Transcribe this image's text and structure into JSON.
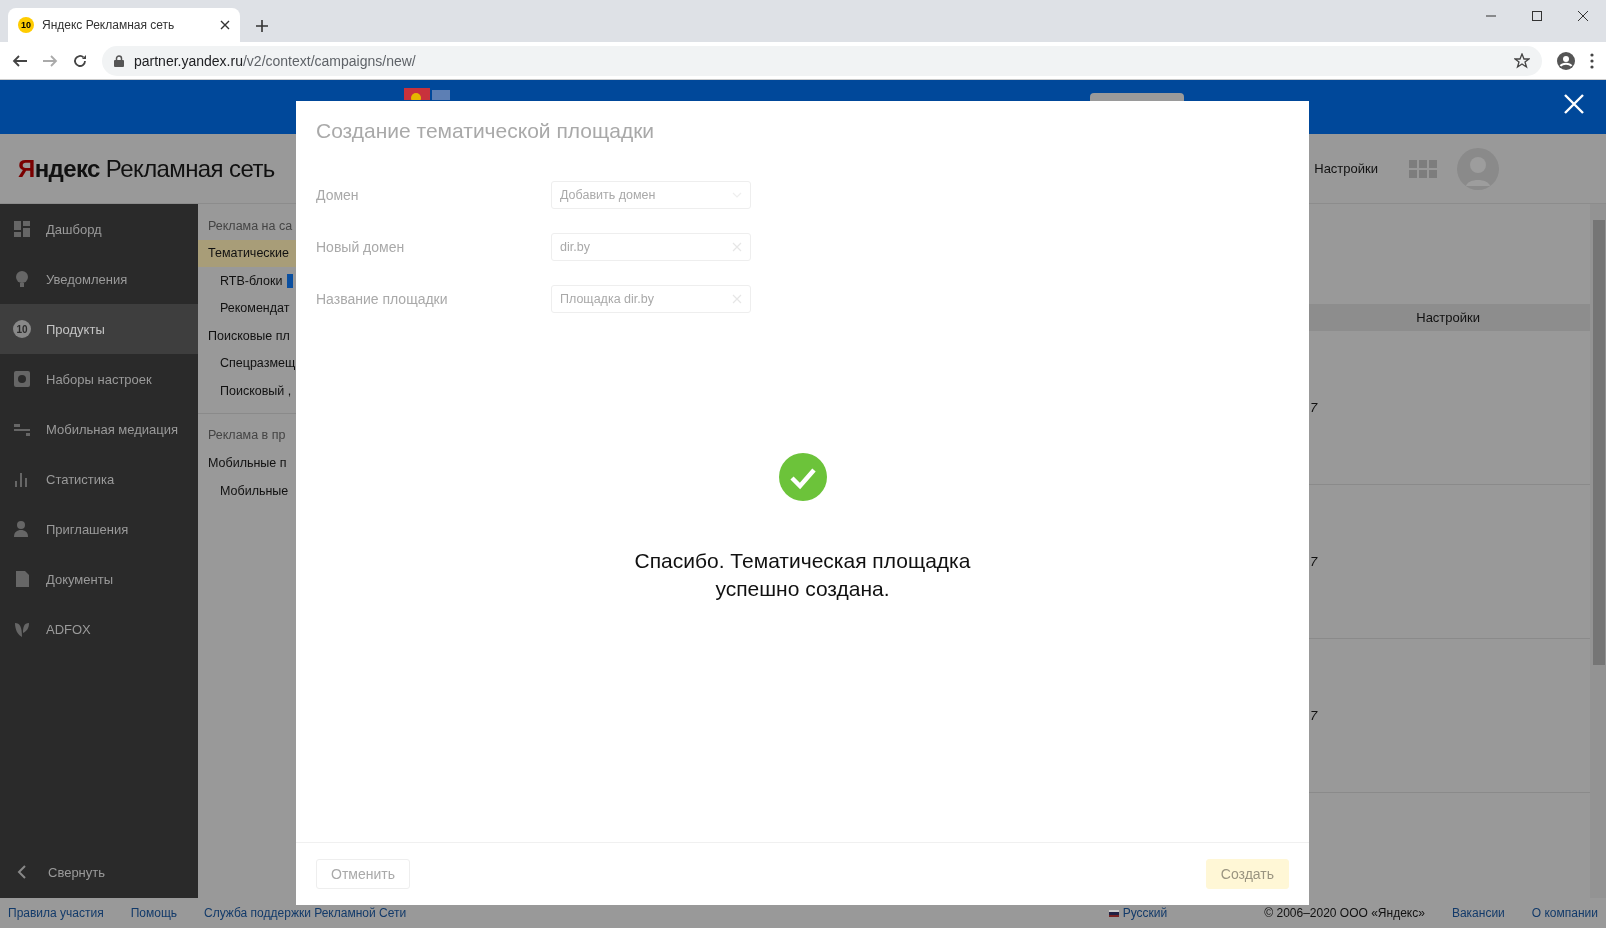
{
  "browser": {
    "tab": {
      "favicon": "10",
      "title": "Яндекс Рекламная сеть",
      "selected": true
    },
    "url_host": "partner.yandex.ru",
    "url_path": "/v2/context/campaigns/new/"
  },
  "header": {
    "logo_brand": "Яндекс",
    "logo_product": "Рекламная сеть",
    "settings": "Настройки"
  },
  "sidebar": {
    "items": [
      {
        "label": "Дашборд",
        "selected": false
      },
      {
        "label": "Уведомления",
        "selected": false
      },
      {
        "label": "Продукты",
        "selected": true,
        "badge": "10"
      },
      {
        "label": "Наборы настроек",
        "selected": false
      },
      {
        "label": "Мобильная медиация",
        "selected": false
      },
      {
        "label": "Статистика",
        "selected": false
      },
      {
        "label": "Приглашения",
        "selected": false
      },
      {
        "label": "Документы",
        "selected": false
      },
      {
        "label": "ADFOX",
        "selected": false
      }
    ],
    "collapse": "Свернуть"
  },
  "submenu": [
    {
      "kind": "heading",
      "label": "Реклама на са"
    },
    {
      "kind": "group",
      "label": "Тематические",
      "selected": true
    },
    {
      "kind": "item",
      "label": "RTB-блоки",
      "tag": true
    },
    {
      "kind": "item",
      "label": "Рекомендат"
    },
    {
      "kind": "group",
      "label": "Поисковые пл"
    },
    {
      "kind": "item",
      "label": "Спецразмещ"
    },
    {
      "kind": "item",
      "label": "Поисковый ,"
    },
    {
      "kind": "heading",
      "label": "Реклама в пр",
      "divider": true
    },
    {
      "kind": "group",
      "label": "Мобильные п"
    },
    {
      "kind": "item",
      "label": "Мобильные"
    }
  ],
  "table": {
    "header": "Настройки",
    "rows": [
      "7",
      "7",
      "7"
    ]
  },
  "footer": {
    "links": [
      "Правила участия",
      "Помощь",
      "Служба поддержки Рекламной Сети"
    ],
    "language": "Русский",
    "copyright": "© 2006–2020 ООО «Яндекс»",
    "right_links": [
      "Вакансии",
      "О компании"
    ]
  },
  "modal": {
    "title": "Создание тематической площадки",
    "faded": true,
    "fields": [
      {
        "kind": "select",
        "label": "Домен",
        "placeholder": "Добавить домен"
      },
      {
        "kind": "input",
        "label": "Новый домен",
        "value": "dir.by"
      },
      {
        "kind": "input",
        "label": "Название площадки",
        "value": "Площадка dir.by"
      }
    ],
    "message": "Спасибо. Тематическая площадка успешно создана.",
    "buttons": [
      {
        "kind": "cancel",
        "label": "Отменить",
        "disabled": true
      },
      {
        "kind": "submit",
        "label": "Создать",
        "disabled": true
      }
    ]
  }
}
